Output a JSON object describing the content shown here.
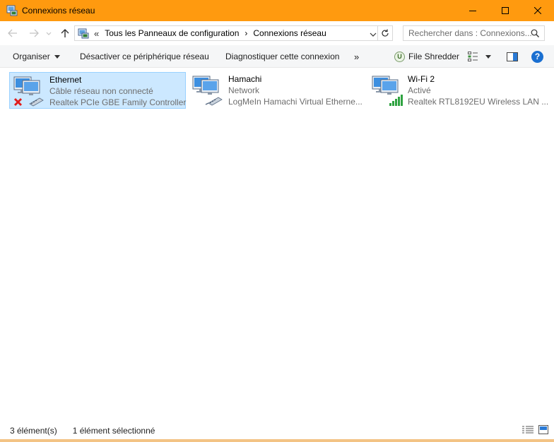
{
  "window": {
    "title": "Connexions réseau"
  },
  "nav": {
    "breadcrumb_overflow": "«",
    "breadcrumb": [
      "Tous les Panneaux de configuration",
      "Connexions réseau"
    ],
    "search_placeholder": "Rechercher dans : Connexions..."
  },
  "toolbar": {
    "organize": "Organiser",
    "disable": "Désactiver ce périphérique réseau",
    "diagnose": "Diagnostiquer cette connexion",
    "more": "»",
    "file_shredder": "File Shredder"
  },
  "connections": [
    {
      "name": "Ethernet",
      "status": "Câble réseau non connecté",
      "device": "Realtek PCIe GBE Family Controller",
      "icon": "ethernet-disconnected-icon",
      "selected": true
    },
    {
      "name": "Hamachi",
      "status": "Network",
      "device": "LogMeIn Hamachi Virtual Etherne...",
      "icon": "network-adapter-icon",
      "selected": false
    },
    {
      "name": "Wi-Fi 2",
      "status": "Activé",
      "device": "Realtek RTL8192EU Wireless LAN ...",
      "icon": "wifi-adapter-icon",
      "selected": false
    }
  ],
  "status": {
    "count": "3 élément(s)",
    "selected": "1 élément sélectionné"
  },
  "colors": {
    "titlebar": "#ff9a0f",
    "selection": "#cce8ff",
    "selection_border": "#99d1ff"
  }
}
